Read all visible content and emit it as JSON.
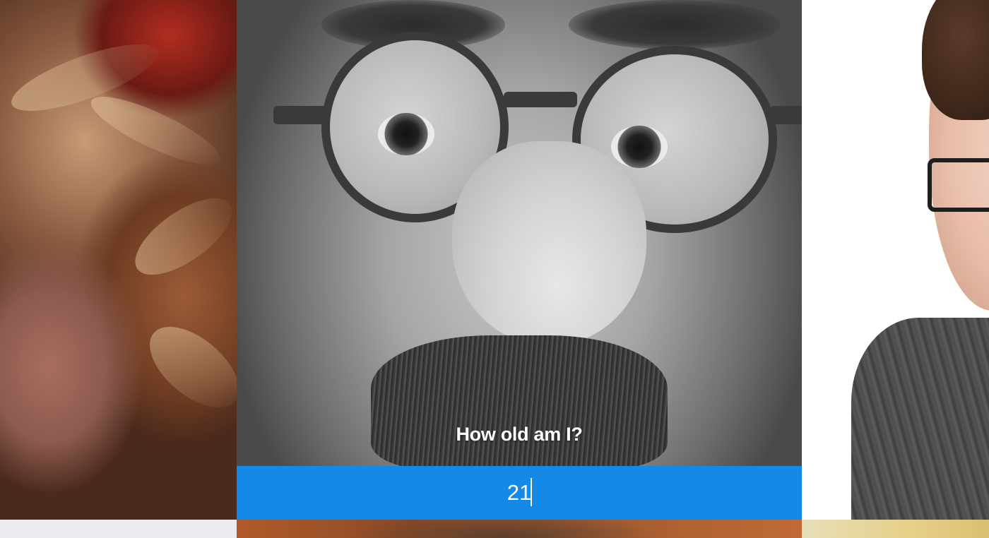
{
  "quiz": {
    "prompt": "How old am I?",
    "answer_value": "21"
  },
  "colors": {
    "answer_bar": "#1589e6",
    "prompt_text": "#ffffff"
  },
  "photos": {
    "left": "portrait-photo",
    "center": "portrait-photo",
    "right": "portrait-photo"
  }
}
